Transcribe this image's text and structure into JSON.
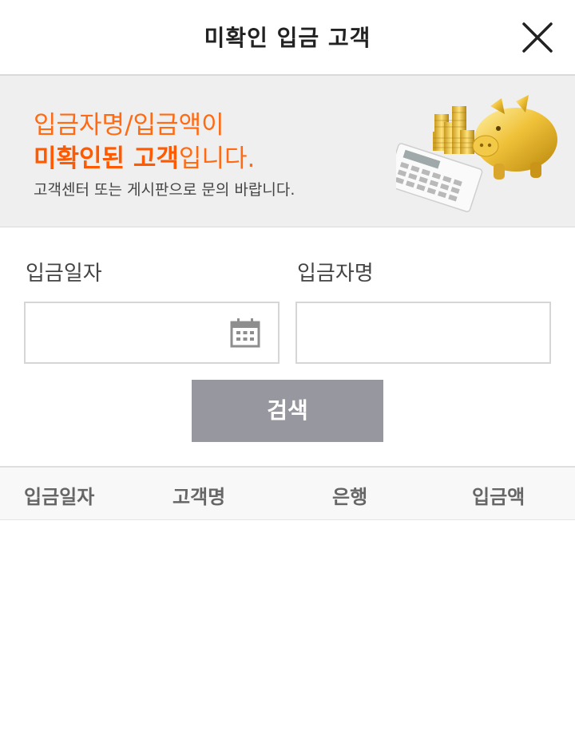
{
  "header": {
    "title": "미확인 입금 고객"
  },
  "banner": {
    "line1": "입금자명/입금액이",
    "line2_strong": "미확인된 고객",
    "line2_rest": "입니다.",
    "line3": "고객센터 또는 게시판으로 문의 바랍니다."
  },
  "form": {
    "date_label": "입금일자",
    "name_label": "입금자명",
    "date_value": "",
    "name_value": "",
    "search_label": "검색"
  },
  "table": {
    "columns": [
      "입금일자",
      "고객명",
      "은행",
      "입금액"
    ],
    "rows": []
  },
  "colors": {
    "accent": "#ff6a13",
    "search_button": "#97979f",
    "banner_bg": "#efefef"
  },
  "icons": {
    "close": "close-icon",
    "calendar": "calendar-icon",
    "banner": "piggy-bank-calculator-illustration"
  }
}
